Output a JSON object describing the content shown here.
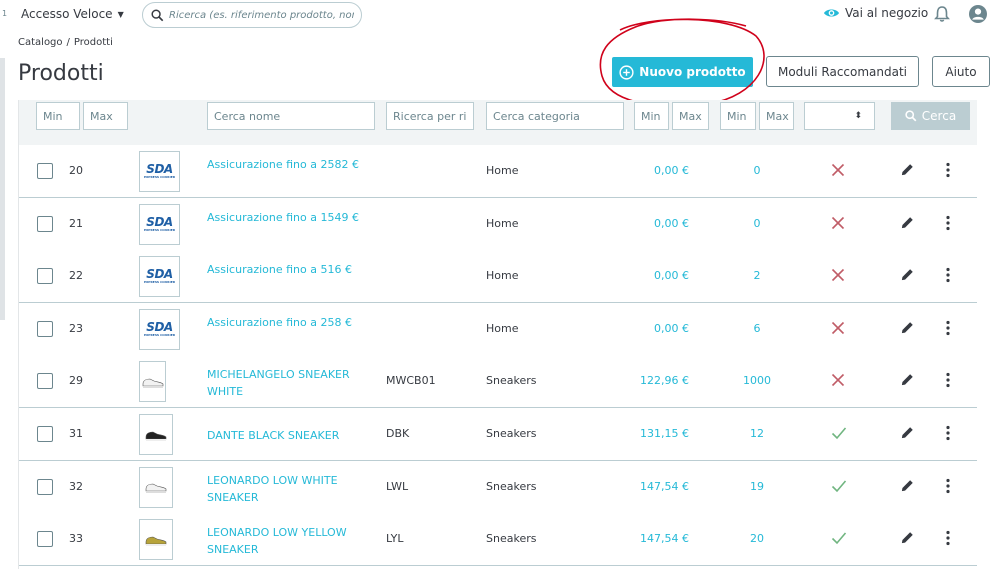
{
  "topbar": {
    "left_marker": "1",
    "quick_access": "Accesso Veloce",
    "search_placeholder": "Ricerca (es. riferimento prodotto, nome",
    "view_shop": "Vai al negozio"
  },
  "header": {
    "breadcrumb": [
      "Catalogo",
      "/",
      "Prodotti"
    ],
    "title": "Prodotti",
    "add_product": "Nuovo prodotto",
    "recommended_modules": "Moduli Raccomandati",
    "help": "Aiuto"
  },
  "filters": {
    "id_min": "Min",
    "id_max": "Max",
    "name": "Cerca nome",
    "reference": "Ricerca per ri",
    "category": "Cerca categoria",
    "price_min": "Min",
    "price_max": "Max",
    "qty_min": "Min",
    "qty_max": "Max",
    "search_button": "Cerca"
  },
  "products": [
    {
      "id": "20",
      "thumb": "sda-logo",
      "name": "Assicurazione fino a 2582 €",
      "reference": "",
      "category": "Home",
      "price": "0,00 €",
      "quantity": "0",
      "status": "disabled"
    },
    {
      "id": "21",
      "thumb": "sda-logo",
      "name": "Assicurazione fino a 1549 €",
      "reference": "",
      "category": "Home",
      "price": "0,00 €",
      "quantity": "0",
      "status": "disabled"
    },
    {
      "id": "22",
      "thumb": "sda-logo",
      "name": "Assicurazione fino a 516 €",
      "reference": "",
      "category": "Home",
      "price": "0,00 €",
      "quantity": "2",
      "status": "disabled"
    },
    {
      "id": "23",
      "thumb": "sda-logo",
      "name": "Assicurazione fino a 258 €",
      "reference": "",
      "category": "Home",
      "price": "0,00 €",
      "quantity": "6",
      "status": "disabled"
    },
    {
      "id": "29",
      "thumb": "sneaker-white",
      "name": "MICHELANGELO SNEAKER WHITE",
      "reference": "MWCB01",
      "category": "Sneakers",
      "price": "122,96 €",
      "quantity": "1000",
      "status": "disabled"
    },
    {
      "id": "31",
      "thumb": "sneaker-black",
      "name": "DANTE BLACK SNEAKER",
      "reference": "DBK",
      "category": "Sneakers",
      "price": "131,15 €",
      "quantity": "12",
      "status": "enabled"
    },
    {
      "id": "32",
      "thumb": "sneaker-white",
      "name": "LEONARDO LOW WHITE SNEAKER",
      "reference": "LWL",
      "category": "Sneakers",
      "price": "147,54 €",
      "quantity": "19",
      "status": "enabled"
    },
    {
      "id": "33",
      "thumb": "sneaker-yellow",
      "name": "LEONARDO LOW YELLOW SNEAKER",
      "reference": "LYL",
      "category": "Sneakers",
      "price": "147,54 €",
      "quantity": "20",
      "status": "enabled"
    }
  ],
  "sda_logo": {
    "text": "SDA",
    "subtext": "EXPRESS COURIER"
  },
  "colors": {
    "accent": "#25b9d7",
    "disabled": "#c05c67",
    "enabled": "#70b580",
    "text": "#363a41",
    "annotation": "#d0021b"
  }
}
